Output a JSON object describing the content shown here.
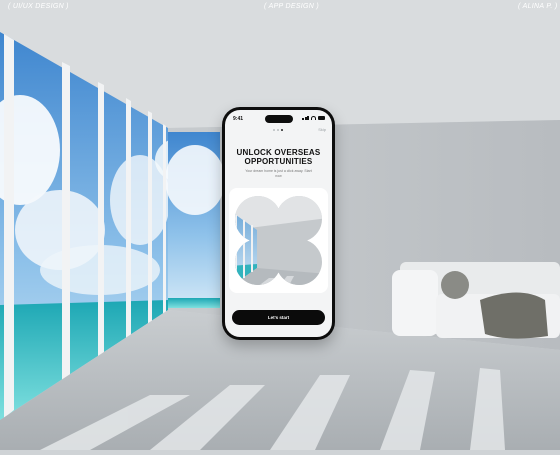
{
  "header": {
    "left_label": "( UI/UX DESIGN )",
    "center_label": "( APP DESIGN )",
    "right_label": "( ALINA P. )"
  },
  "phone": {
    "status_time": "9:41",
    "skip_label": "Skip",
    "page_indicator": {
      "total": 3,
      "active": 3
    },
    "title_line1": "UNLOCK OVERSEAS",
    "title_line2": "OPPORTUNITIES",
    "subtitle": "Your dream home is just a click away. Start now",
    "cta_label": "Let's start"
  }
}
